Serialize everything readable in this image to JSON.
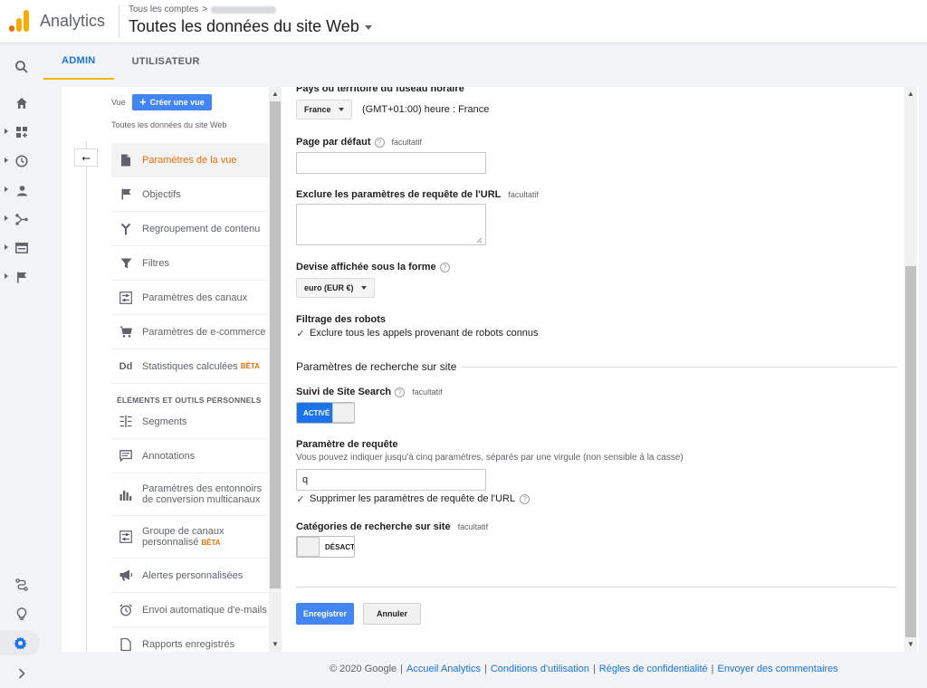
{
  "header": {
    "app_name": "Analytics",
    "breadcrumb_prefix": "Tous les comptes",
    "breadcrumb_sep": ">",
    "view_title": "Toutes les données du site Web"
  },
  "tabs": [
    {
      "label": "ADMIN",
      "active": true
    },
    {
      "label": "UTILISATEUR",
      "active": false
    }
  ],
  "rail": {
    "icons": [
      "search-icon",
      "home-icon",
      "dashboard-icon",
      "clock-icon",
      "person-icon",
      "acquisition-icon",
      "display-icon",
      "flag-icon",
      "route-icon",
      "lightbulb-icon",
      "settings-icon",
      "chevron-right-icon"
    ]
  },
  "left_panel": {
    "vue_label": "Vue",
    "create_view": "Créer une vue",
    "view_name": "Toutes les données du site Web",
    "back_arrow": "⭠",
    "menu": [
      {
        "label": "Paramètres de la vue",
        "icon": "document-icon",
        "active": true
      },
      {
        "label": "Objectifs",
        "icon": "flag-icon"
      },
      {
        "label": "Regroupement de contenu",
        "icon": "merge-icon"
      },
      {
        "label": "Filtres",
        "icon": "filter-icon"
      },
      {
        "label": "Paramètres des canaux",
        "icon": "channel-icon"
      },
      {
        "label": "Paramètres de e-commerce",
        "icon": "cart-icon"
      },
      {
        "label": "Statistiques calculées",
        "icon": "dd-icon",
        "beta": "BÊTA"
      }
    ],
    "section_title": "ÉLÉMENTS ET OUTILS PERSONNELS",
    "menu_perso": [
      {
        "label": "Segments",
        "icon": "segments-icon"
      },
      {
        "label": "Annotations",
        "icon": "comment-icon"
      },
      {
        "label_l1": "Paramètres des entonnoirs",
        "label_l2": "de conversion multicanaux",
        "icon": "bar-chart-icon"
      },
      {
        "label_l1": "Groupe de canaux",
        "label_l2": "personnalisé",
        "beta": "BÊTA",
        "icon": "channel-group-icon"
      },
      {
        "label": "Alertes personnalisées",
        "icon": "megaphone-icon"
      },
      {
        "label": "Envoi automatique d'e-mails",
        "icon": "alarm-icon"
      },
      {
        "label": "Rapports enregistrés",
        "icon": "file-icon"
      }
    ]
  },
  "form": {
    "timezone_label": "Pays ou territoire du fuseau horaire",
    "country_value": "France",
    "timezone_value": "(GMT+01:00) heure : France",
    "default_page_label": "Page par défaut",
    "optional": "facultatif",
    "help": "?",
    "default_page_value": "",
    "exclude_params_label": "Exclure les paramètres de requête de l'URL",
    "exclude_params_value": "",
    "currency_label": "Devise affichée sous la forme",
    "currency_value": "euro (EUR €)",
    "bot_filter_label": "Filtrage des robots",
    "bot_filter_checkbox": "Exclure tous les appels provenant de robots connus",
    "site_search_heading": "Paramètres de recherche sur site",
    "site_search_tracking_label": "Suivi de Site Search",
    "toggle_on": "ACTIVÉ",
    "query_param_label": "Paramètre de requête",
    "query_param_hint": "Vous pouvez indiquer jusqu'à cinq paramètres, séparés par une virgule (non sensible à la casse)",
    "query_param_value": "q",
    "strip_params_checkbox": "Supprimer les paramètres de requête de l'URL",
    "categories_label": "Catégories de recherche sur site",
    "toggle_off": "DÉSACT",
    "save": "Enregistrer",
    "cancel": "Annuler"
  },
  "footer": {
    "copyright": "© 2020 Google",
    "sep": "|",
    "links": [
      "Accueil Analytics",
      "Conditions d'utilisation",
      "Règles de confidentialité",
      "Envoyer des commentaires"
    ]
  },
  "colors": {
    "accent": "#1a73e8",
    "active_menu": "#e8710a",
    "logo_orange": "#f9ab00",
    "logo_dark": "#e37400"
  }
}
